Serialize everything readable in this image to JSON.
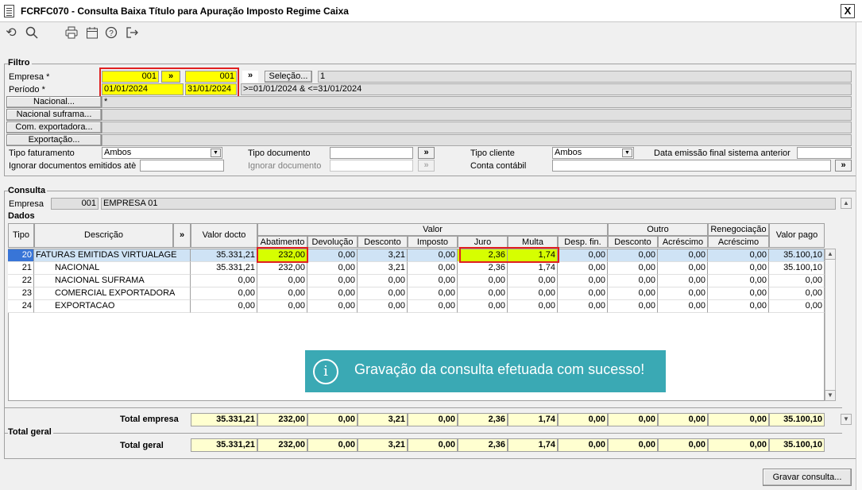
{
  "window": {
    "title": "FCRFC070 - Consulta Baixa Título para Apuração Imposto Regime Caixa",
    "close": "X"
  },
  "icons": {
    "refresh": "refresh-icon",
    "search": "search-icon",
    "print": "printer-icon",
    "calendar": "calendar-icon",
    "help": "help-icon",
    "exit": "exit-icon"
  },
  "filtro": {
    "section": "Filtro",
    "empresa_label": "Empresa *",
    "empresa_from": "001",
    "empresa_to": "001",
    "arrow": "»",
    "periodo_label": "Período *",
    "periodo_from": "01/01/2024",
    "periodo_to": "31/01/2024",
    "selecao_btn": "Seleção...",
    "selecao_value": "1",
    "periodo_expr": ">=01/01/2024 & <=31/01/2024",
    "nacional_btn": "Nacional...",
    "nacional_value": "*",
    "suframa_btn": "Nacional suframa...",
    "comexp_btn": "Com. exportadora...",
    "exportacao_btn": "Exportação...",
    "tipo_fat_label": "Tipo faturamento",
    "tipo_fat_value": "Ambos",
    "tipo_doc_label": "Tipo documento",
    "tipo_cli_label": "Tipo cliente",
    "tipo_cli_value": "Ambos",
    "data_emissao_label": "Data emissão final sistema anterior",
    "ignorar_emit_label": "Ignorar documentos emitidos atè",
    "ignorar_doc_label": "Ignorar documento",
    "conta_label": "Conta contábil"
  },
  "consulta": {
    "section": "Consulta",
    "empresa_label": "Empresa",
    "empresa_code": "001",
    "empresa_name": "EMPRESA 01"
  },
  "dados": {
    "section": "Dados",
    "headers": {
      "tipo": "Tipo",
      "descricao": "Descrição",
      "arrow": "»",
      "valor_docto": "Valor docto",
      "valor": "Valor",
      "abatimento": "Abatimento",
      "devolucao": "Devolução",
      "desconto": "Desconto",
      "imposto": "Imposto",
      "juro": "Juro",
      "multa": "Multa",
      "desp_fin": "Desp. fin.",
      "outro": "Outro",
      "outro_desconto": "Desconto",
      "outro_acrescimo": "Acréscimo",
      "renegociacao": "Renegociação",
      "reneg_acrescimo": "Acréscimo",
      "valor_pago": "Valor pago"
    },
    "rows": [
      {
        "tipo": "20",
        "descricao": "FATURAS EMITIDAS VIRTUALAGE",
        "valor_docto": "35.331,21",
        "abatimento": "232,00",
        "devolucao": "0,00",
        "desconto": "3,21",
        "imposto": "0,00",
        "juro": "2,36",
        "multa": "1,74",
        "desp_fin": "0,00",
        "outro_desconto": "0,00",
        "outro_acrescimo": "0,00",
        "reneg_acrescimo": "0,00",
        "valor_pago": "35.100,10"
      },
      {
        "tipo": "21",
        "descricao": "NACIONAL",
        "valor_docto": "35.331,21",
        "abatimento": "232,00",
        "devolucao": "0,00",
        "desconto": "3,21",
        "imposto": "0,00",
        "juro": "2,36",
        "multa": "1,74",
        "desp_fin": "0,00",
        "outro_desconto": "0,00",
        "outro_acrescimo": "0,00",
        "reneg_acrescimo": "0,00",
        "valor_pago": "35.100,10"
      },
      {
        "tipo": "22",
        "descricao": "NACIONAL SUFRAMA",
        "valor_docto": "0,00",
        "abatimento": "0,00",
        "devolucao": "0,00",
        "desconto": "0,00",
        "imposto": "0,00",
        "juro": "0,00",
        "multa": "0,00",
        "desp_fin": "0,00",
        "outro_desconto": "0,00",
        "outro_acrescimo": "0,00",
        "reneg_acrescimo": "0,00",
        "valor_pago": "0,00"
      },
      {
        "tipo": "23",
        "descricao": "COMERCIAL EXPORTADORA",
        "valor_docto": "0,00",
        "abatimento": "0,00",
        "devolucao": "0,00",
        "desconto": "0,00",
        "imposto": "0,00",
        "juro": "0,00",
        "multa": "0,00",
        "desp_fin": "0,00",
        "outro_desconto": "0,00",
        "outro_acrescimo": "0,00",
        "reneg_acrescimo": "0,00",
        "valor_pago": "0,00"
      },
      {
        "tipo": "24",
        "descricao": "EXPORTACAO",
        "valor_docto": "0,00",
        "abatimento": "0,00",
        "devolucao": "0,00",
        "desconto": "0,00",
        "imposto": "0,00",
        "juro": "0,00",
        "multa": "0,00",
        "desp_fin": "0,00",
        "outro_desconto": "0,00",
        "outro_acrescimo": "0,00",
        "reneg_acrescimo": "0,00",
        "valor_pago": "0,00"
      }
    ]
  },
  "totals": {
    "empresa_label": "Total empresa",
    "geral_section": "Total geral",
    "geral_label": "Total geral",
    "empresa": [
      "35.331,21",
      "232,00",
      "0,00",
      "3,21",
      "0,00",
      "2,36",
      "1,74",
      "0,00",
      "0,00",
      "0,00",
      "0,00",
      "35.100,10"
    ],
    "geral": [
      "35.331,21",
      "232,00",
      "0,00",
      "3,21",
      "0,00",
      "2,36",
      "1,74",
      "0,00",
      "0,00",
      "0,00",
      "0,00",
      "35.100,10"
    ]
  },
  "toast": {
    "message": "Gravação da consulta efetuada com sucesso!",
    "icon": "info-icon",
    "color": "#3aa9b4"
  },
  "gravar_btn": "Gravar consulta...",
  "colors": {
    "highlight": "#ffff00",
    "lime": "#d6ff00",
    "redbox": "#e02020",
    "selected": "#cfe3f5"
  }
}
